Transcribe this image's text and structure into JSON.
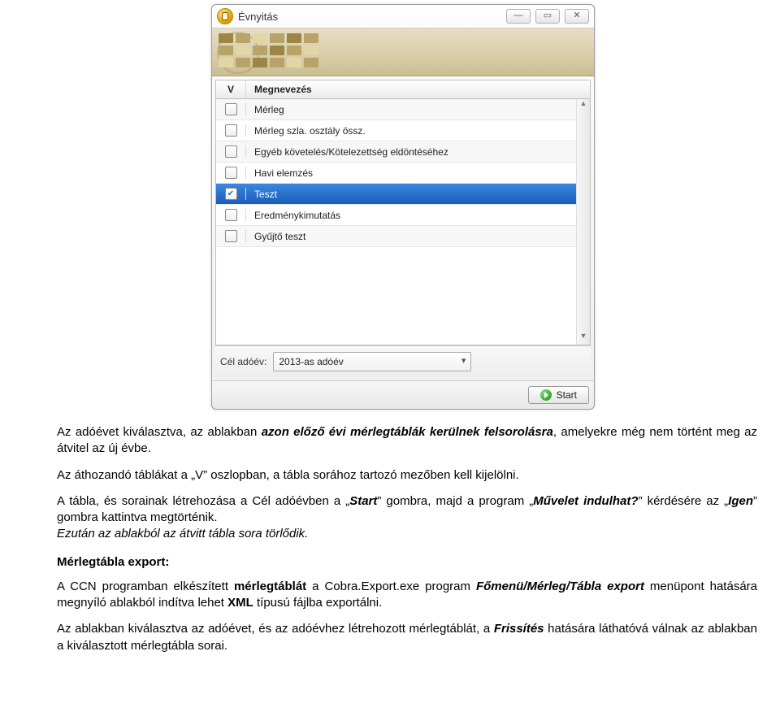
{
  "window": {
    "title": "Évnyitás",
    "headers": {
      "v": "V",
      "name": "Megnevezés"
    },
    "rows": [
      {
        "label": "Mérleg",
        "checked": false,
        "selected": false
      },
      {
        "label": "Mérleg szla. osztály össz.",
        "checked": false,
        "selected": false
      },
      {
        "label": "Egyéb követelés/Kötelezettség eldöntéséhez",
        "checked": false,
        "selected": false
      },
      {
        "label": "Havi elemzés",
        "checked": false,
        "selected": false
      },
      {
        "label": "Teszt",
        "checked": true,
        "selected": true
      },
      {
        "label": "Eredménykimutatás",
        "checked": false,
        "selected": false
      },
      {
        "label": "Gyűjtő teszt",
        "checked": false,
        "selected": false
      }
    ],
    "cel_label": "Cél adóév:",
    "cel_value": "2013-as adóév",
    "start_label": "Start"
  },
  "doc": {
    "p1_a": "Az adóévet kiválasztva, az ablakban ",
    "p1_b": "azon előző évi mérlegtáblák kerülnek felsorolásra",
    "p1_c": ", amelyekre még nem történt meg az átvitel az új évbe.",
    "p2": "Az áthozandó táblákat a „V” oszlopban, a tábla sorához tartozó mezőben kell kijelölni.",
    "p3_a": "A tábla, és sorainak létrehozása a Cél adóévben a „",
    "p3_start": "Start",
    "p3_b": "” gombra, majd a program „",
    "p3_muv": "Művelet indulhat?",
    "p3_c": "” kérdésére az „",
    "p3_igen": "Igen",
    "p3_d": "” gombra kattintva megtörténik.",
    "p3_e": "Ezután az ablakból az átvitt tábla sora törlődik.",
    "heading": "Mérlegtábla export:",
    "p4_a": "A CCN programban elkészített ",
    "p4_b": "mérlegtáblát",
    "p4_c": " a Cobra.Export.exe program ",
    "p4_d": "Főmenü/Mérleg/Tábla export",
    "p4_e": " menüpont hatására megnyíló ablakból indítva lehet ",
    "p4_f": "XML",
    "p4_g": " típusú fájlba exportálni.",
    "p5_a": "Az ablakban kiválasztva az adóévet, és az adóévhez létrehozott mérlegtáblát, a ",
    "p5_b": "Frissítés",
    "p5_c": " hatására láthatóvá válnak az ablakban a kiválasztott mérlegtábla sorai."
  }
}
